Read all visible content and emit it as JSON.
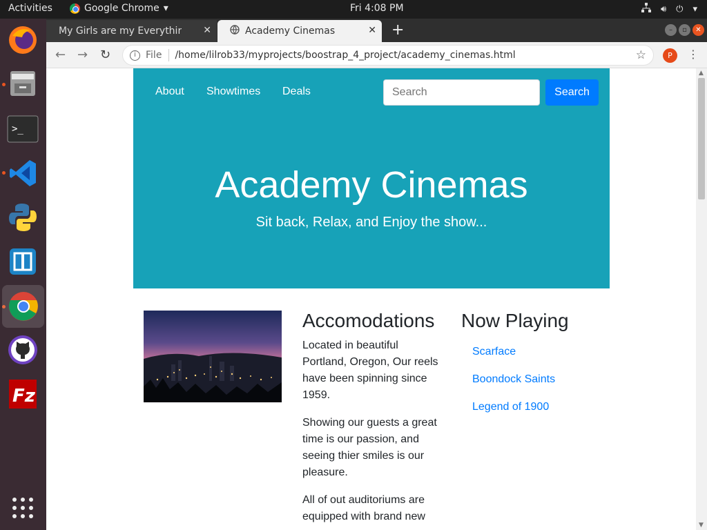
{
  "system": {
    "activities": "Activities",
    "app_name": "Google Chrome",
    "clock": "Fri  4:08 PM"
  },
  "dock": {
    "apps": [
      "firefox-icon",
      "files-icon",
      "terminal-icon",
      "vscode-icon",
      "python-icon",
      "blueprint-icon",
      "chrome-icon",
      "github-icon",
      "filezilla-icon",
      "app-grid-icon"
    ]
  },
  "browser": {
    "tabs": [
      {
        "title": "My Girls are my Everything"
      },
      {
        "title": "Academy Cinemas"
      }
    ],
    "url_scheme": "File",
    "url": "/home/lilrob33/myprojects/boostrap_4_project/academy_cinemas.html",
    "profile_initial": "P"
  },
  "page": {
    "nav": [
      "About",
      "Showtimes",
      "Deals"
    ],
    "search_placeholder": "Search",
    "search_button": "Search",
    "hero_title": "Academy Cinemas",
    "hero_subtitle": "Sit back, Relax, and Enjoy the show...",
    "accommodations": {
      "heading": "Accomodations",
      "paragraphs": [
        "Located in beautiful Portland, Oregon, Our reels have been spinning since 1959.",
        "Showing our guests a great time is our passion, and seeing thier smiles is our pleasure.",
        "All of out auditoriums are equipped with brand new"
      ]
    },
    "now_playing": {
      "heading": "Now Playing",
      "movies": [
        "Scarface",
        "Boondock Saints",
        "Legend of 1900"
      ]
    }
  },
  "colors": {
    "hero_bg": "#17a2b8",
    "primary": "#007bff",
    "ubuntu_orange": "#e95420"
  }
}
